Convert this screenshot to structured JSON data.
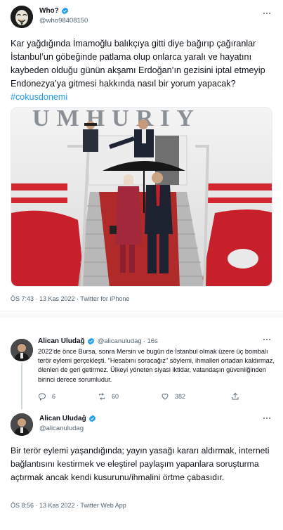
{
  "main_tweet": {
    "display_name": "Who?",
    "handle": "@who98408150",
    "text_body": "Kar yağdığında İmamoğlu balıkçıya gitti diye bağırıp çağıranlar İstanbul’un göbeğinde patlama olup onlarca yaralı ve hayatını kaybeden olduğu günün akşamı Erdoğan’ın gezisini iptal etmeyip Endonezya’ya gitmesi hakkında nasıl bir yorum yapacak?",
    "hashtag": "#cokusdonemi",
    "photo_lettering": "UMHURIY",
    "meta": "ÖS 7:43 · 13 Kas 2022 · Twitter for iPhone"
  },
  "reply": {
    "display_name": "Alican Uludağ",
    "handle": "@alicanuludag",
    "time": "· 16s",
    "text": "2022'de önce Bursa, sonra Mersin ve bugün de İstanbul olmak üzere üç bombalı terör eylemi gerçekleşti. \"Hesabını soracağız\" söylemi, ihmalleri ortadan kaldırmaz, ölenleri de geri getirmez. Ülkeyi yöneten siyasi iktidar, vatandaşın güvenliğinden birinci derece sorumludur.",
    "reply_count": "6",
    "retweet_count": "60",
    "like_count": "382"
  },
  "second_tweet": {
    "display_name": "Alican Uludağ",
    "handle": "@alicanuludag",
    "text": "Bir terör eylemi yaşandığında; yayın yasağı kararı aldırmak, interneti bağlantısını kestirmek ve eleştirel paylaşım yapanlara soruşturma açtırmak ancak kendi kusurunu/ihmalini örtme çabasıdır.",
    "meta": "ÖS 8:56 · 13 Kas 2022 · Twitter Web App"
  },
  "colors": {
    "accent": "#1d9bf0",
    "text": "#0f1419",
    "secondary": "#536471"
  }
}
